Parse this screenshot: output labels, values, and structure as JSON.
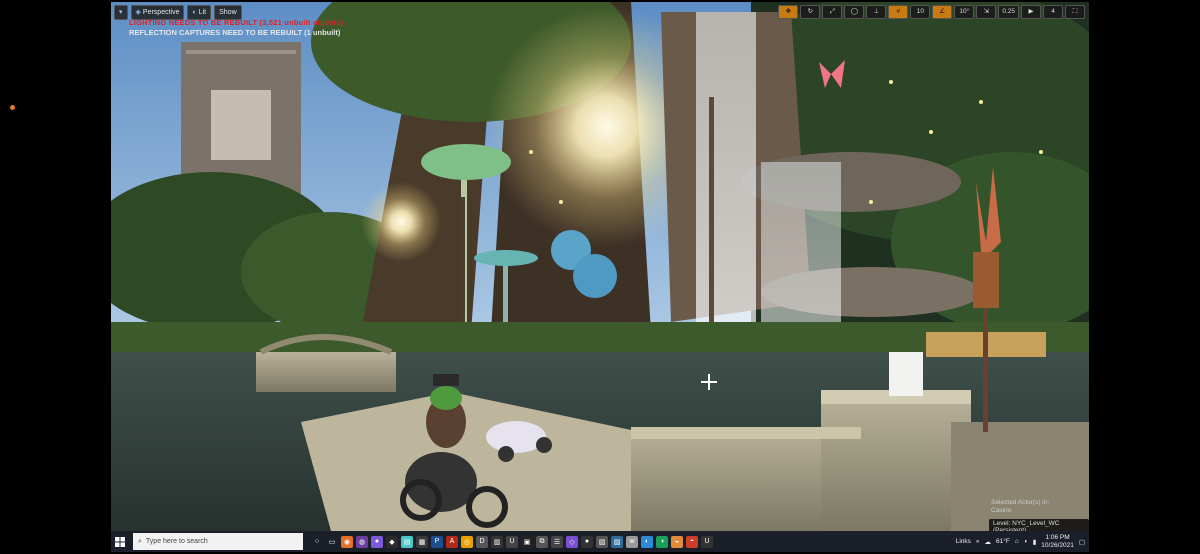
{
  "viewport": {
    "toolbar": {
      "perspective_label": "Perspective",
      "lit_label": "Lit",
      "show_label": "Show"
    },
    "warnings": {
      "lighting": "LIGHTING NEEDS TO BE REBUILT (3,521 unbuilt objects)",
      "reflection": "REFLECTION CAPTURES NEED TO BE REBUILT (1 unbuilt)"
    },
    "right_controls": {
      "grid_snap": "10",
      "rotation_snap": "10°",
      "scale_snap": "0.25",
      "camera_speed": "4"
    },
    "selection": {
      "line1": "Selected Actor(s) in:",
      "line2": "Casino",
      "level": "Level:  NYC_Level_WC (Persistent)"
    }
  },
  "taskbar": {
    "search_placeholder": "Type here to search",
    "links_label": "Links",
    "weather": "61°F",
    "time": "1:06 PM",
    "date": "10/26/2021"
  },
  "colors": {
    "warning_red": "#e0202a",
    "accent_orange": "#c97a10",
    "taskbar_bg": "#1b1f2a"
  }
}
